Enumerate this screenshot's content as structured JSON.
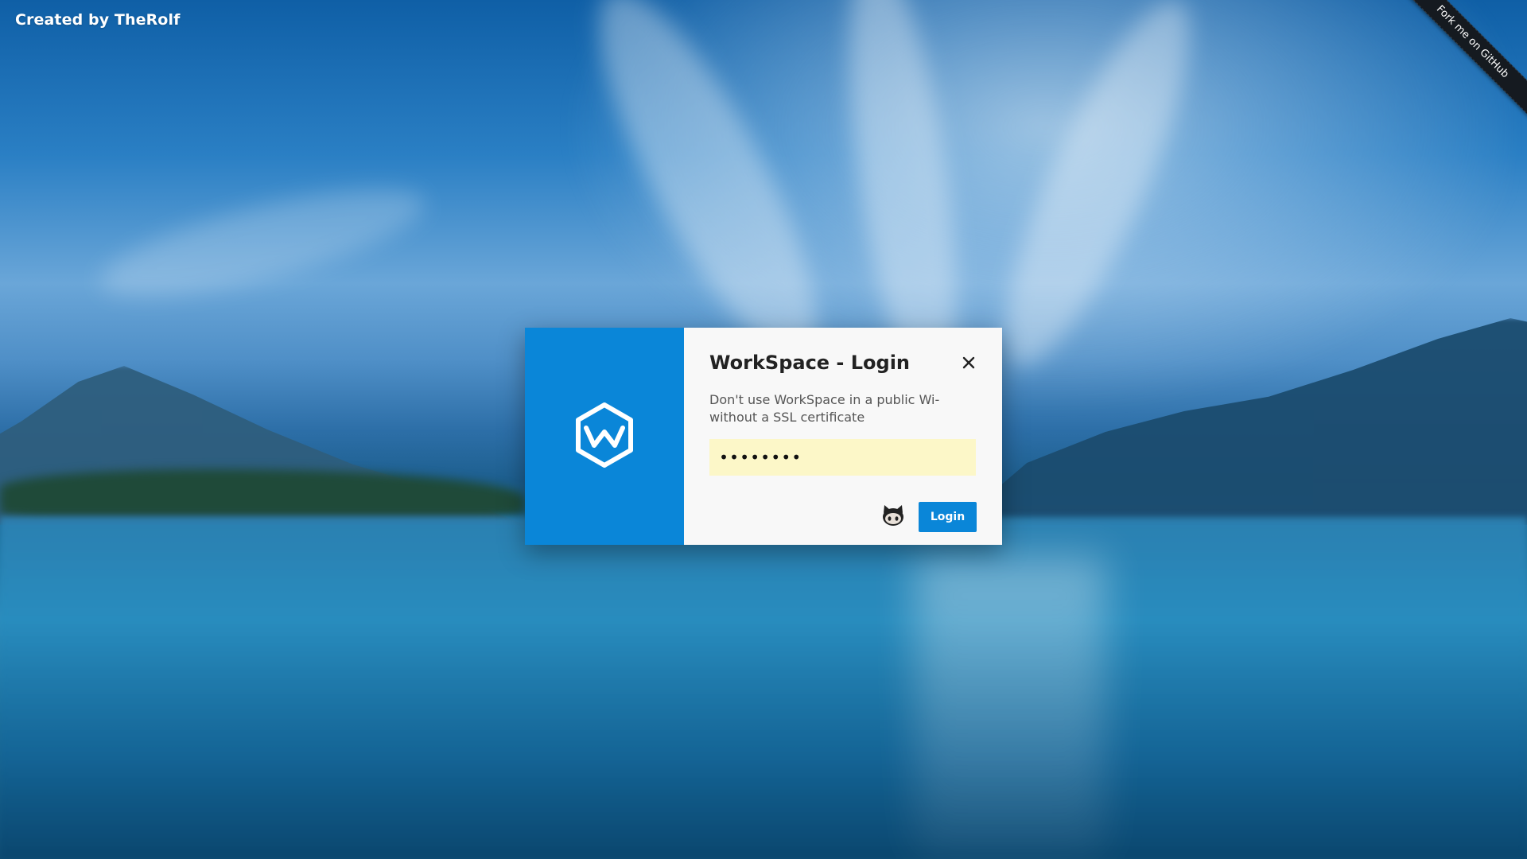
{
  "page": {
    "credit_text": "Created by TheRolf",
    "ribbon_text": "Fork me on GitHub"
  },
  "dialog": {
    "title": "WorkSpace - Login",
    "warning": "Don't use WorkSpace in a public Wi- without a SSL certificate",
    "password_value": "••••••••",
    "login_label": "Login",
    "logo_icon": "workspace-hexagon-w-icon",
    "close_icon": "close-icon",
    "github_icon": "github-octocat-icon"
  },
  "colors": {
    "accent": "#0a86d8",
    "panel_bg": "#f8f8f8",
    "input_bg": "#fcf7c8",
    "ribbon_bg": "#151a20"
  }
}
